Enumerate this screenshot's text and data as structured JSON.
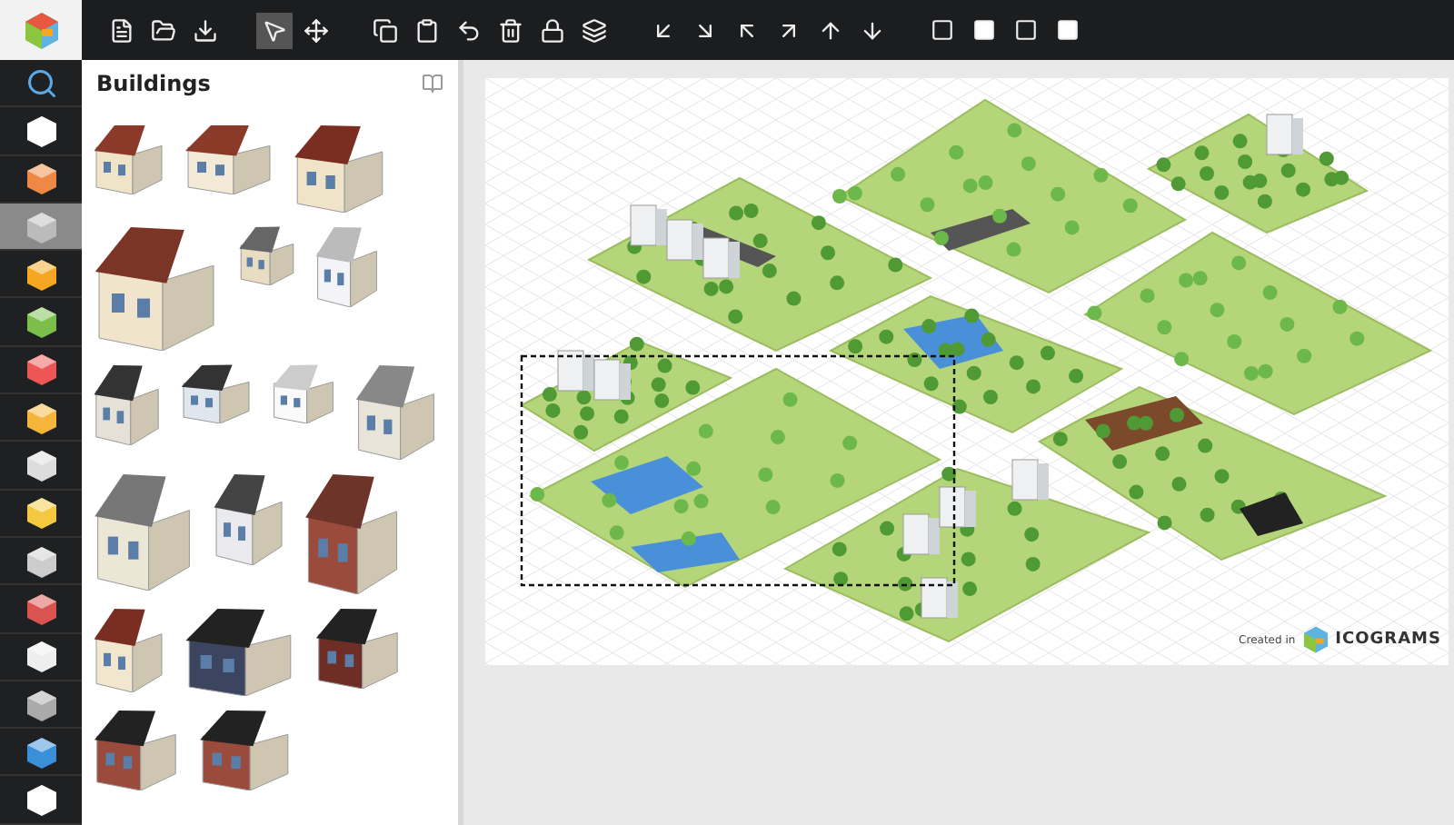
{
  "panel": {
    "title": "Buildings"
  },
  "categories": [
    {
      "selected": false
    },
    {
      "selected": false
    },
    {
      "selected": false
    },
    {
      "selected": true
    },
    {
      "selected": false
    },
    {
      "selected": false
    },
    {
      "selected": false
    },
    {
      "selected": false
    },
    {
      "selected": false
    },
    {
      "selected": false
    },
    {
      "selected": false
    },
    {
      "selected": false
    },
    {
      "selected": false
    },
    {
      "selected": false
    },
    {
      "selected": false
    },
    {
      "selected": false
    }
  ],
  "canvas": {
    "credit": "Created in",
    "brand": "ICOGRAMS"
  }
}
